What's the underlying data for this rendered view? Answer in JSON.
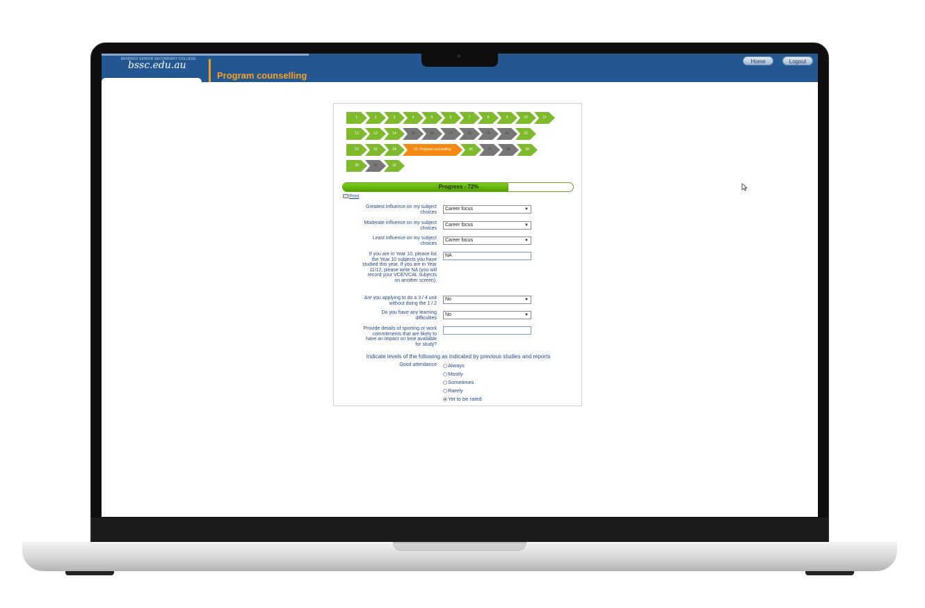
{
  "header": {
    "logo_small": "BENDIGO SENIOR SECONDARY COLLEGE",
    "logo_main": "bssc.edu.au",
    "page_heading": "Program counselling",
    "home_label": "Home",
    "logout_label": "Logout"
  },
  "steps": {
    "rows": [
      [
        {
          "label": "1.",
          "status": "done"
        },
        {
          "label": "2",
          "status": "done"
        },
        {
          "label": "3",
          "status": "done"
        },
        {
          "label": "4",
          "status": "done"
        },
        {
          "label": "5",
          "status": "done"
        },
        {
          "label": "6",
          "status": "done"
        },
        {
          "label": "7",
          "status": "done"
        },
        {
          "label": "8",
          "status": "done"
        },
        {
          "label": "9",
          "status": "done"
        },
        {
          "label": "10",
          "status": "done"
        },
        {
          "label": "11",
          "status": "done"
        }
      ],
      [
        {
          "label": "12",
          "status": "done"
        },
        {
          "label": "13",
          "status": "done"
        },
        {
          "label": "14",
          "status": "done"
        },
        {
          "label": "15",
          "status": "pending"
        },
        {
          "label": "16",
          "status": "pending"
        },
        {
          "label": "17",
          "status": "pending"
        },
        {
          "label": "18",
          "status": "pending"
        },
        {
          "label": "19",
          "status": "pending"
        },
        {
          "label": "20",
          "status": "pending"
        },
        {
          "label": "21",
          "status": "done"
        }
      ],
      [
        {
          "label": "22",
          "status": "done"
        },
        {
          "label": "23",
          "status": "done"
        },
        {
          "label": "24",
          "status": "done"
        },
        {
          "label": "25. Program counselling",
          "status": "current"
        },
        {
          "label": "26",
          "status": "done"
        },
        {
          "label": "27",
          "status": "pending"
        },
        {
          "label": "28",
          "status": "pending"
        },
        {
          "label": "29",
          "status": "done"
        }
      ],
      [
        {
          "label": "30",
          "status": "done"
        },
        {
          "label": "31",
          "status": "pending"
        },
        {
          "label": "32",
          "status": "done"
        }
      ]
    ]
  },
  "progress": {
    "label": "Progress - 72%",
    "fraction": 0.72
  },
  "print_label": "Print",
  "form": {
    "greatest_label": "Greatest influence on my subject choices",
    "greatest_value": "Career focus",
    "moderate_label": "Moderate influence on my subject choices",
    "moderate_value": "Career focus",
    "least_label": "Least influence on my subject choices",
    "least_value": "Career focus",
    "year10_label": "If you are in Year 10, please list the Year 10 subjects you have studied this year. If you are in Year 11/12, please write NA (you will record your VCE/VCAL subjects on another screen).",
    "year10_value": "NA",
    "unit34_label": "Are you applying to do a 3 / 4 unit without doing the 1 / 2",
    "unit34_value": "No",
    "learning_label": "Do you have any learning difficulties",
    "learning_value": "No",
    "sporting_label": "Provide details of sporting or work commitments that are likely to have an impact on time available for study?",
    "sporting_value": "",
    "levels_title": "Indicate levels of the following as indicated by previous studies and reports",
    "attendance_label": "Good attendance",
    "attendance_options": [
      "Always",
      "Mostly",
      "Sometimes",
      "Rarely",
      "Yet to be rated"
    ],
    "attendance_selected": "Yet to be rated"
  },
  "colors": {
    "header_blue": "#255793",
    "heading_orange": "#f7a21e",
    "step_done": "#7dbb2c",
    "step_pending": "#777777",
    "step_current": "#f48a12",
    "progress_green": "#5bb000",
    "label_blue": "#254a85"
  },
  "icons": [
    "printer-icon",
    "dropdown-arrow-icon",
    "mouse-cursor-icon"
  ]
}
